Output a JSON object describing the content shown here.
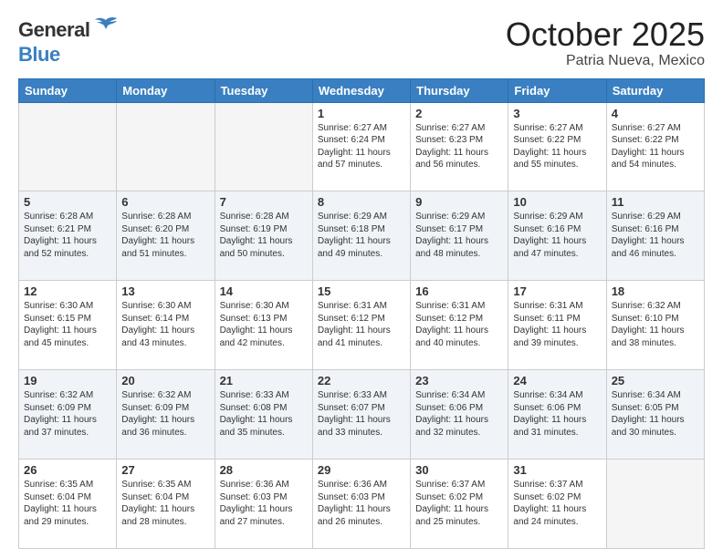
{
  "header": {
    "logo_general": "General",
    "logo_blue": "Blue",
    "month_title": "October 2025",
    "location": "Patria Nueva, Mexico"
  },
  "days_of_week": [
    "Sunday",
    "Monday",
    "Tuesday",
    "Wednesday",
    "Thursday",
    "Friday",
    "Saturday"
  ],
  "weeks": [
    [
      {
        "day": "",
        "info": ""
      },
      {
        "day": "",
        "info": ""
      },
      {
        "day": "",
        "info": ""
      },
      {
        "day": "1",
        "info": "Sunrise: 6:27 AM\nSunset: 6:24 PM\nDaylight: 11 hours\nand 57 minutes."
      },
      {
        "day": "2",
        "info": "Sunrise: 6:27 AM\nSunset: 6:23 PM\nDaylight: 11 hours\nand 56 minutes."
      },
      {
        "day": "3",
        "info": "Sunrise: 6:27 AM\nSunset: 6:22 PM\nDaylight: 11 hours\nand 55 minutes."
      },
      {
        "day": "4",
        "info": "Sunrise: 6:27 AM\nSunset: 6:22 PM\nDaylight: 11 hours\nand 54 minutes."
      }
    ],
    [
      {
        "day": "5",
        "info": "Sunrise: 6:28 AM\nSunset: 6:21 PM\nDaylight: 11 hours\nand 52 minutes."
      },
      {
        "day": "6",
        "info": "Sunrise: 6:28 AM\nSunset: 6:20 PM\nDaylight: 11 hours\nand 51 minutes."
      },
      {
        "day": "7",
        "info": "Sunrise: 6:28 AM\nSunset: 6:19 PM\nDaylight: 11 hours\nand 50 minutes."
      },
      {
        "day": "8",
        "info": "Sunrise: 6:29 AM\nSunset: 6:18 PM\nDaylight: 11 hours\nand 49 minutes."
      },
      {
        "day": "9",
        "info": "Sunrise: 6:29 AM\nSunset: 6:17 PM\nDaylight: 11 hours\nand 48 minutes."
      },
      {
        "day": "10",
        "info": "Sunrise: 6:29 AM\nSunset: 6:16 PM\nDaylight: 11 hours\nand 47 minutes."
      },
      {
        "day": "11",
        "info": "Sunrise: 6:29 AM\nSunset: 6:16 PM\nDaylight: 11 hours\nand 46 minutes."
      }
    ],
    [
      {
        "day": "12",
        "info": "Sunrise: 6:30 AM\nSunset: 6:15 PM\nDaylight: 11 hours\nand 45 minutes."
      },
      {
        "day": "13",
        "info": "Sunrise: 6:30 AM\nSunset: 6:14 PM\nDaylight: 11 hours\nand 43 minutes."
      },
      {
        "day": "14",
        "info": "Sunrise: 6:30 AM\nSunset: 6:13 PM\nDaylight: 11 hours\nand 42 minutes."
      },
      {
        "day": "15",
        "info": "Sunrise: 6:31 AM\nSunset: 6:12 PM\nDaylight: 11 hours\nand 41 minutes."
      },
      {
        "day": "16",
        "info": "Sunrise: 6:31 AM\nSunset: 6:12 PM\nDaylight: 11 hours\nand 40 minutes."
      },
      {
        "day": "17",
        "info": "Sunrise: 6:31 AM\nSunset: 6:11 PM\nDaylight: 11 hours\nand 39 minutes."
      },
      {
        "day": "18",
        "info": "Sunrise: 6:32 AM\nSunset: 6:10 PM\nDaylight: 11 hours\nand 38 minutes."
      }
    ],
    [
      {
        "day": "19",
        "info": "Sunrise: 6:32 AM\nSunset: 6:09 PM\nDaylight: 11 hours\nand 37 minutes."
      },
      {
        "day": "20",
        "info": "Sunrise: 6:32 AM\nSunset: 6:09 PM\nDaylight: 11 hours\nand 36 minutes."
      },
      {
        "day": "21",
        "info": "Sunrise: 6:33 AM\nSunset: 6:08 PM\nDaylight: 11 hours\nand 35 minutes."
      },
      {
        "day": "22",
        "info": "Sunrise: 6:33 AM\nSunset: 6:07 PM\nDaylight: 11 hours\nand 33 minutes."
      },
      {
        "day": "23",
        "info": "Sunrise: 6:34 AM\nSunset: 6:06 PM\nDaylight: 11 hours\nand 32 minutes."
      },
      {
        "day": "24",
        "info": "Sunrise: 6:34 AM\nSunset: 6:06 PM\nDaylight: 11 hours\nand 31 minutes."
      },
      {
        "day": "25",
        "info": "Sunrise: 6:34 AM\nSunset: 6:05 PM\nDaylight: 11 hours\nand 30 minutes."
      }
    ],
    [
      {
        "day": "26",
        "info": "Sunrise: 6:35 AM\nSunset: 6:04 PM\nDaylight: 11 hours\nand 29 minutes."
      },
      {
        "day": "27",
        "info": "Sunrise: 6:35 AM\nSunset: 6:04 PM\nDaylight: 11 hours\nand 28 minutes."
      },
      {
        "day": "28",
        "info": "Sunrise: 6:36 AM\nSunset: 6:03 PM\nDaylight: 11 hours\nand 27 minutes."
      },
      {
        "day": "29",
        "info": "Sunrise: 6:36 AM\nSunset: 6:03 PM\nDaylight: 11 hours\nand 26 minutes."
      },
      {
        "day": "30",
        "info": "Sunrise: 6:37 AM\nSunset: 6:02 PM\nDaylight: 11 hours\nand 25 minutes."
      },
      {
        "day": "31",
        "info": "Sunrise: 6:37 AM\nSunset: 6:02 PM\nDaylight: 11 hours\nand 24 minutes."
      },
      {
        "day": "",
        "info": ""
      }
    ]
  ]
}
